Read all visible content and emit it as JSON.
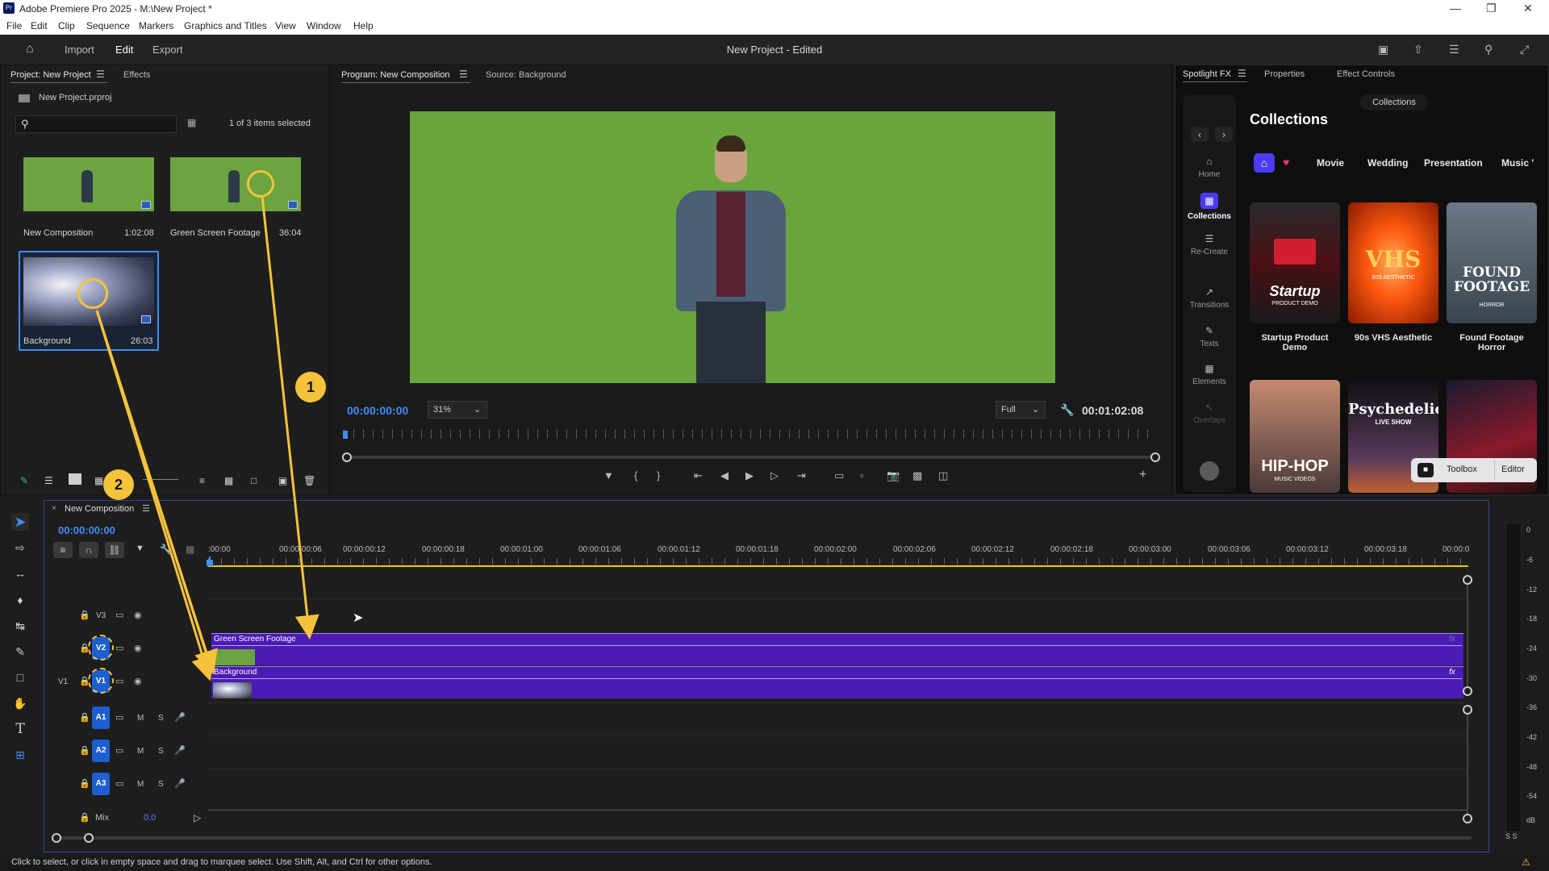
{
  "app": {
    "title": "Adobe Premiere Pro 2025 - M:\\New Project *",
    "logo": "Pr"
  },
  "menu": [
    "File",
    "Edit",
    "Clip",
    "Sequence",
    "Markers",
    "Graphics and Titles",
    "View",
    "Window",
    "Help"
  ],
  "header": {
    "nav": [
      "Import",
      "Edit",
      "Export"
    ],
    "active": "Edit",
    "center_title": "New Project - Edited"
  },
  "project_panel": {
    "tab_project": "Project: New Project",
    "tab_effects": "Effects",
    "file_name": "New Project.prproj",
    "search_placeholder": "",
    "selection_count": "1 of 3 items selected",
    "items": [
      {
        "name": "New Composition",
        "duration": "1:02:08"
      },
      {
        "name": "Green Screen Footage",
        "duration": "36:04"
      },
      {
        "name": "Background",
        "duration": "26:03"
      }
    ]
  },
  "monitor": {
    "tab_program": "Program: New Composition",
    "tab_source": "Source: Background",
    "timecode_current": "00:00:00:00",
    "zoom": "31%",
    "quality": "Full",
    "timecode_total": "00:01:02:08"
  },
  "spotlight": {
    "tabs": [
      "Spotlight FX",
      "Properties",
      "Effect Controls"
    ],
    "logo": "fx",
    "collections_pill": "Collections",
    "heading": "Collections",
    "sidebar": [
      "Home",
      "Collections",
      "Re-Create",
      "Transitions",
      "Texts",
      "Elements",
      "Overlays"
    ],
    "categories": [
      "Movie",
      "Wedding",
      "Presentation",
      "Music '"
    ],
    "cards": [
      {
        "title": "Startup",
        "subtitle": "PRODUCT DEMO",
        "label": "Startup Product Demo"
      },
      {
        "title": "VHS",
        "subtitle": "90S AESTHETIC",
        "label": "90s VHS Aesthetic"
      },
      {
        "title": "FOUND FOOTAGE",
        "subtitle": "HORROR",
        "label": "Found Footage Horror"
      },
      {
        "title": "HIP-HOP",
        "subtitle": "MUSIC VIDEOS",
        "label": ""
      },
      {
        "title": "Psychedelic",
        "subtitle": "LIVE SHOW",
        "label": ""
      },
      {
        "title": "",
        "subtitle": "",
        "label": ""
      }
    ],
    "toolbox": "Toolbox",
    "editor": "Editor"
  },
  "timeline": {
    "sequence_name": "New Composition",
    "timecode": "00:00:00:00",
    "ruler": [
      ":00:00",
      "00:00:00:06",
      "00:00:00:12",
      "00:00:00:18",
      "00:00:01:00",
      "00:00:01:06",
      "00:00:01:12",
      "00:00:01:18",
      "00:00:02:00",
      "00:00:02:06",
      "00:00:02:12",
      "00:00:02:18",
      "00:00:03:00",
      "00:00:03:06",
      "00:00:03:12",
      "00:00:03:18",
      "00:00:0"
    ],
    "video_tracks": [
      "V3",
      "V2",
      "V1"
    ],
    "source_patch": "V1",
    "audio_tracks": [
      "A1",
      "A2",
      "A3"
    ],
    "audio_m": "M",
    "audio_s": "S",
    "mix_label": "Mix",
    "mix_value": "0.0",
    "clips": [
      {
        "name": "Green Screen Footage",
        "track": "V2"
      },
      {
        "name": "Background",
        "track": "V1"
      }
    ],
    "fx_badge": "fx"
  },
  "meter": {
    "scale": [
      "0",
      "-6",
      "-12",
      "-18",
      "-24",
      "-30",
      "-36",
      "-42",
      "-48",
      "-54",
      "dB"
    ],
    "solo": "S S"
  },
  "annotations": [
    "1",
    "2"
  ],
  "status_bar": "Click to select, or click in empty space and drag to marquee select. Use Shift, Alt, and Ctrl for other options.",
  "colors": {
    "accent_blue": "#3e8ef7",
    "clip_purple": "#4a1bb5",
    "annotation_yellow": "#f5c23b",
    "green_screen": "#6aa43c"
  }
}
